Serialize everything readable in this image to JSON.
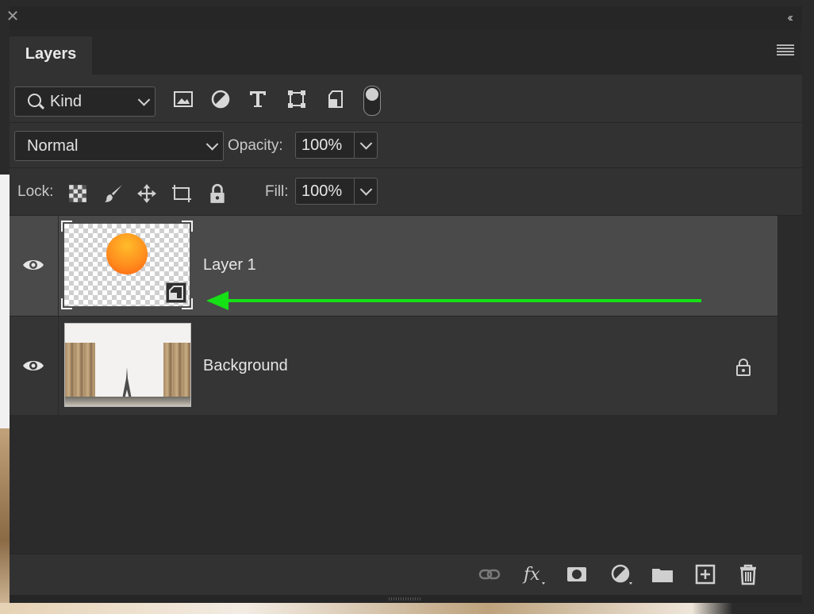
{
  "panel": {
    "tab_label": "Layers"
  },
  "filter": {
    "kind_label": "Kind",
    "icons": [
      "image-icon",
      "adjustment-icon",
      "type-icon",
      "shape-icon",
      "smart-object-icon"
    ]
  },
  "blend": {
    "mode": "Normal",
    "opacity_label": "Opacity:",
    "opacity_value": "100%"
  },
  "lock": {
    "label": "Lock:",
    "fill_label": "Fill:",
    "fill_value": "100%",
    "icons": [
      "lock-transparent-pixels-icon",
      "lock-image-pixels-icon",
      "lock-position-icon",
      "lock-artboard-icon",
      "lock-all-icon"
    ]
  },
  "layers": [
    {
      "name": "Layer 1",
      "visible": true,
      "selected": true,
      "smart_object": true
    },
    {
      "name": "Background",
      "visible": true,
      "selected": false,
      "locked": true
    }
  ],
  "annotation": {
    "arrow_color": "#16e016"
  },
  "footer": {
    "icons": [
      "link-layers-icon",
      "fx-icon",
      "add-mask-icon",
      "new-adjustment-icon",
      "new-group-icon",
      "new-layer-icon",
      "delete-layer-icon"
    ]
  }
}
